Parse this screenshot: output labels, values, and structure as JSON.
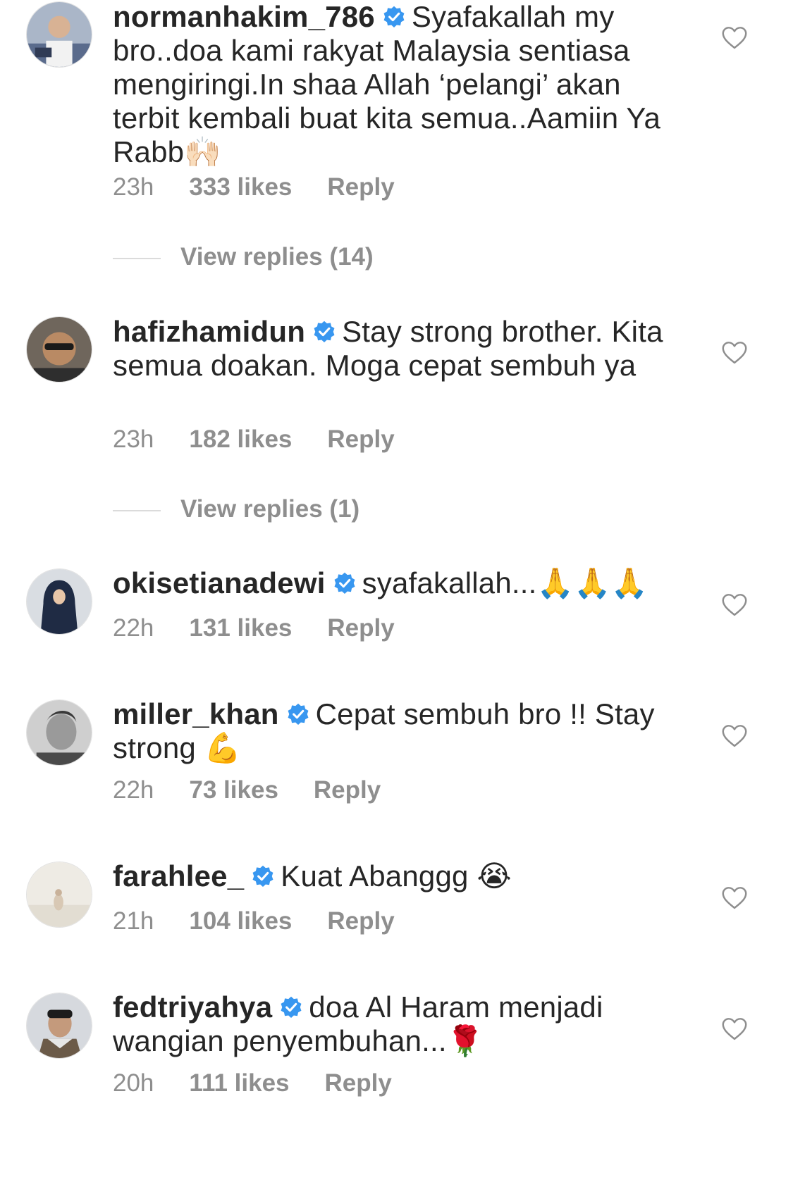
{
  "comments": [
    {
      "username": "normanhakim_786",
      "text": "Syafakallah my bro..doa kami rakyat Malaysia sentiasa mengiringi.In shaa Allah ‘pelangi’ akan terbit kembali buat kita semua..Aamiin Ya Rabb",
      "emoji": "🙌🏻",
      "time": "23h",
      "likes": "333 likes",
      "reply": "Reply",
      "view_replies": "View replies (14)"
    },
    {
      "username": "hafizhamidun",
      "text": "Stay strong brother. Kita semua doakan. Moga cepat sembuh ya",
      "emoji": "",
      "time": "23h",
      "likes": "182 likes",
      "reply": "Reply",
      "view_replies": "View replies (1)"
    },
    {
      "username": "okisetianadewi",
      "text": "syafakallah...",
      "emoji": "🙏🙏🙏",
      "time": "22h",
      "likes": "131 likes",
      "reply": "Reply"
    },
    {
      "username": "miller_khan",
      "text": "Cepat sembuh bro !! Stay strong",
      "emoji": "💪",
      "time": "22h",
      "likes": "73 likes",
      "reply": "Reply"
    },
    {
      "username": "farahlee_",
      "text": "Kuat Abanggg",
      "emoji": "😭",
      "time": "21h",
      "likes": "104 likes",
      "reply": "Reply"
    },
    {
      "username": "fedtriyahya",
      "text": "doa Al Haram menjadi wangian penyembuhan...",
      "emoji": "🌹",
      "time": "20h",
      "likes": "111 likes",
      "reply": "Reply"
    }
  ],
  "colors": {
    "text": "#262626",
    "secondary": "#8e8e8e",
    "verified": "#3897f0",
    "divider": "#dbdbdb"
  },
  "icons": {
    "verified": "verified-badge-icon",
    "like": "heart-outline-icon"
  }
}
